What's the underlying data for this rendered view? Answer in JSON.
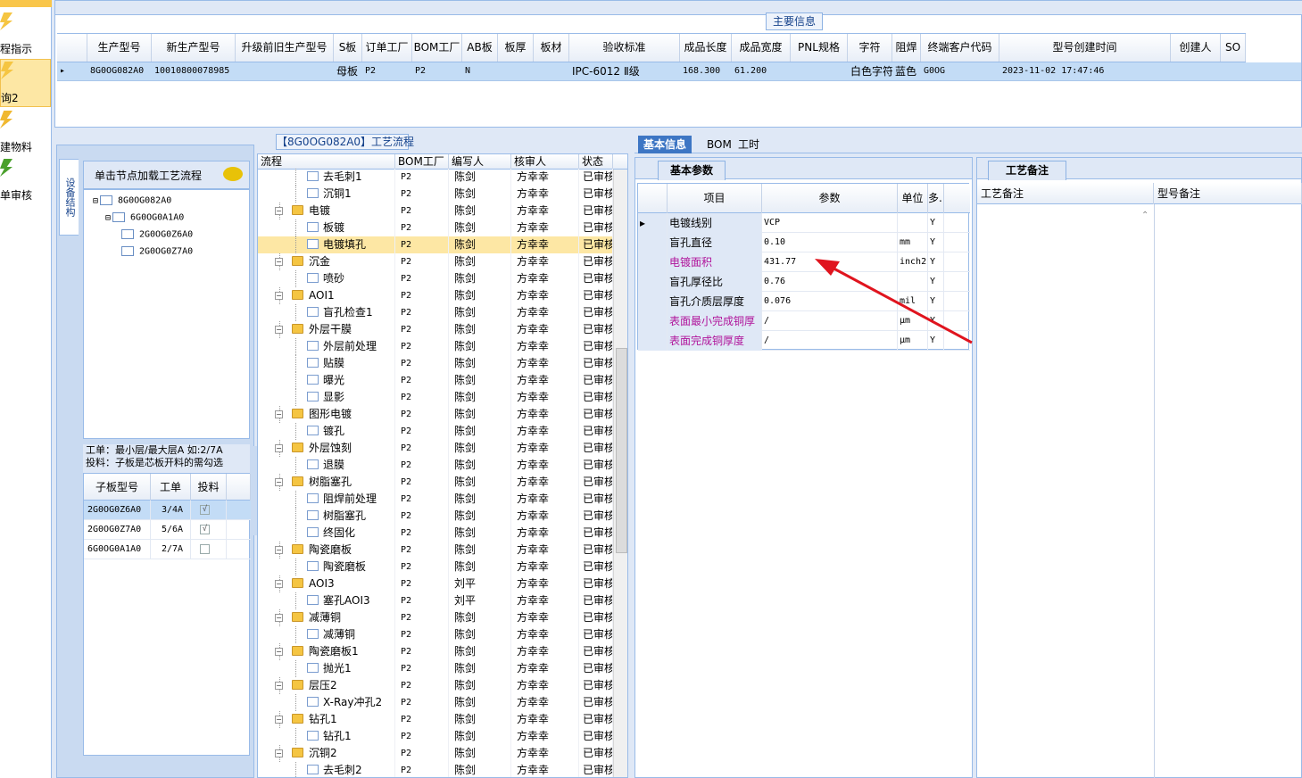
{
  "left_nav": {
    "items": [
      {
        "label": "程指示",
        "active": false
      },
      {
        "label": "询2",
        "active": true
      },
      {
        "label": "建物料",
        "active": false
      },
      {
        "label": "单审核",
        "active": false
      }
    ]
  },
  "main_info": {
    "title": "主要信息",
    "columns": [
      "生产型号",
      "新生产型号",
      "升级前旧生产型号",
      "S板",
      "订单工厂",
      "BOM工厂",
      "AB板",
      "板厚",
      "板材",
      "验收标准",
      "成品长度",
      "成品宽度",
      "PNL规格",
      "字符",
      "阻焊",
      "终端客户代码",
      "型号创建时间",
      "创建人",
      "SO"
    ],
    "row": [
      "8G0OG082A0",
      "10010800078985",
      "",
      "母板",
      "P2",
      "P2",
      "N",
      "",
      "",
      "IPC-6012 Ⅱ级",
      "168.300",
      "61.200",
      "",
      "白色字符",
      "蓝色",
      "G0OG",
      "2023-11-02 17:47:46",
      "",
      ""
    ]
  },
  "tree": {
    "tab_label": "设备结构",
    "load_label": "单击节点加载工艺流程",
    "nodes": [
      "8G0OG082A0",
      "6G0OG0A1A0",
      "2G0OG0Z6A0",
      "2G0OG0Z7A0"
    ],
    "note_line1": "工单：最小层/最大层A 如:2/7A",
    "note_line2": "投料：子板是芯板开料的需勾选"
  },
  "sub_board": {
    "columns": [
      "子板型号",
      "工单",
      "投料"
    ],
    "rows": [
      {
        "model": "2G0OG0Z6A0",
        "order": "3/4A",
        "feed": "√"
      },
      {
        "model": "2G0OG0Z7A0",
        "order": "5/6A",
        "feed": "√"
      },
      {
        "model": "6G0OG0A1A0",
        "order": "2/7A",
        "feed": ""
      }
    ]
  },
  "flow": {
    "title": "【8G0OG082A0】工艺流程",
    "columns": [
      "流程",
      "BOM工厂",
      "编写人",
      "核审人",
      "状态"
    ],
    "rows": [
      {
        "name": "去毛刺1",
        "level": 2,
        "bom": "P2",
        "writer": "陈剑",
        "reviewer": "方幸幸",
        "status": "已审核"
      },
      {
        "name": "沉铜1",
        "level": 2,
        "bom": "P2",
        "writer": "陈剑",
        "reviewer": "方幸幸",
        "status": "已审核"
      },
      {
        "name": "电镀",
        "level": 1,
        "bom": "P2",
        "writer": "陈剑",
        "reviewer": "方幸幸",
        "status": "已审核"
      },
      {
        "name": "板镀",
        "level": 2,
        "bom": "P2",
        "writer": "陈剑",
        "reviewer": "方幸幸",
        "status": "已审核"
      },
      {
        "name": "电镀填孔",
        "level": 2,
        "bom": "P2",
        "writer": "陈剑",
        "reviewer": "方幸幸",
        "status": "已审核",
        "selected": true
      },
      {
        "name": "沉金",
        "level": 1,
        "bom": "P2",
        "writer": "陈剑",
        "reviewer": "方幸幸",
        "status": "已审核"
      },
      {
        "name": "喷砂",
        "level": 2,
        "bom": "P2",
        "writer": "陈剑",
        "reviewer": "方幸幸",
        "status": "已审核"
      },
      {
        "name": "AOI1",
        "level": 1,
        "bom": "P2",
        "writer": "陈剑",
        "reviewer": "方幸幸",
        "status": "已审核"
      },
      {
        "name": "盲孔检查1",
        "level": 2,
        "bom": "P2",
        "writer": "陈剑",
        "reviewer": "方幸幸",
        "status": "已审核"
      },
      {
        "name": "外层干膜",
        "level": 1,
        "bom": "P2",
        "writer": "陈剑",
        "reviewer": "方幸幸",
        "status": "已审核"
      },
      {
        "name": "外层前处理",
        "level": 2,
        "bom": "P2",
        "writer": "陈剑",
        "reviewer": "方幸幸",
        "status": "已审核"
      },
      {
        "name": "贴膜",
        "level": 2,
        "bom": "P2",
        "writer": "陈剑",
        "reviewer": "方幸幸",
        "status": "已审核"
      },
      {
        "name": "曝光",
        "level": 2,
        "bom": "P2",
        "writer": "陈剑",
        "reviewer": "方幸幸",
        "status": "已审核"
      },
      {
        "name": "显影",
        "level": 2,
        "bom": "P2",
        "writer": "陈剑",
        "reviewer": "方幸幸",
        "status": "已审核"
      },
      {
        "name": "图形电镀",
        "level": 1,
        "bom": "P2",
        "writer": "陈剑",
        "reviewer": "方幸幸",
        "status": "已审核"
      },
      {
        "name": "镀孔",
        "level": 2,
        "bom": "P2",
        "writer": "陈剑",
        "reviewer": "方幸幸",
        "status": "已审核"
      },
      {
        "name": "外层蚀刻",
        "level": 1,
        "bom": "P2",
        "writer": "陈剑",
        "reviewer": "方幸幸",
        "status": "已审核"
      },
      {
        "name": "退膜",
        "level": 2,
        "bom": "P2",
        "writer": "陈剑",
        "reviewer": "方幸幸",
        "status": "已审核"
      },
      {
        "name": "树脂塞孔",
        "level": 1,
        "bom": "P2",
        "writer": "陈剑",
        "reviewer": "方幸幸",
        "status": "已审核"
      },
      {
        "name": "阻焊前处理",
        "level": 2,
        "bom": "P2",
        "writer": "陈剑",
        "reviewer": "方幸幸",
        "status": "已审核"
      },
      {
        "name": "树脂塞孔",
        "level": 2,
        "bom": "P2",
        "writer": "陈剑",
        "reviewer": "方幸幸",
        "status": "已审核"
      },
      {
        "name": "终固化",
        "level": 2,
        "bom": "P2",
        "writer": "陈剑",
        "reviewer": "方幸幸",
        "status": "已审核"
      },
      {
        "name": "陶瓷磨板",
        "level": 1,
        "bom": "P2",
        "writer": "陈剑",
        "reviewer": "方幸幸",
        "status": "已审核"
      },
      {
        "name": "陶瓷磨板",
        "level": 2,
        "bom": "P2",
        "writer": "陈剑",
        "reviewer": "方幸幸",
        "status": "已审核"
      },
      {
        "name": "AOI3",
        "level": 1,
        "bom": "P2",
        "writer": "刘平",
        "reviewer": "方幸幸",
        "status": "已审核"
      },
      {
        "name": "塞孔AOI3",
        "level": 2,
        "bom": "P2",
        "writer": "刘平",
        "reviewer": "方幸幸",
        "status": "已审核"
      },
      {
        "name": "减薄铜",
        "level": 1,
        "bom": "P2",
        "writer": "陈剑",
        "reviewer": "方幸幸",
        "status": "已审核"
      },
      {
        "name": "减薄铜",
        "level": 2,
        "bom": "P2",
        "writer": "陈剑",
        "reviewer": "方幸幸",
        "status": "已审核"
      },
      {
        "name": "陶瓷磨板1",
        "level": 1,
        "bom": "P2",
        "writer": "陈剑",
        "reviewer": "方幸幸",
        "status": "已审核"
      },
      {
        "name": "抛光1",
        "level": 2,
        "bom": "P2",
        "writer": "陈剑",
        "reviewer": "方幸幸",
        "status": "已审核"
      },
      {
        "name": "层压2",
        "level": 1,
        "bom": "P2",
        "writer": "陈剑",
        "reviewer": "方幸幸",
        "status": "已审核"
      },
      {
        "name": "X-Ray冲孔2",
        "level": 2,
        "bom": "P2",
        "writer": "陈剑",
        "reviewer": "方幸幸",
        "status": "已审核"
      },
      {
        "name": "钻孔1",
        "level": 1,
        "bom": "P2",
        "writer": "陈剑",
        "reviewer": "方幸幸",
        "status": "已审核"
      },
      {
        "name": "钻孔1",
        "level": 2,
        "bom": "P2",
        "writer": "陈剑",
        "reviewer": "方幸幸",
        "status": "已审核"
      },
      {
        "name": "沉铜2",
        "level": 1,
        "bom": "P2",
        "writer": "陈剑",
        "reviewer": "方幸幸",
        "status": "已审核"
      },
      {
        "name": "去毛刺2",
        "level": 2,
        "bom": "P2",
        "writer": "陈剑",
        "reviewer": "方幸幸",
        "status": "已审核"
      }
    ]
  },
  "right_tabs": [
    "基本信息",
    "BOM",
    "工时"
  ],
  "basic_params": {
    "tab": "基本参数",
    "columns": [
      "项目",
      "参数",
      "单位",
      "多.."
    ],
    "rows": [
      {
        "item": "电镀线别",
        "value": "VCP",
        "unit": "",
        "flag": "Y",
        "magenta": false
      },
      {
        "item": "盲孔直径",
        "value": "0.10",
        "unit": "mm",
        "flag": "Y",
        "magenta": false
      },
      {
        "item": "电镀面积",
        "value": "431.77",
        "unit": "inch2",
        "flag": "Y",
        "magenta": true
      },
      {
        "item": "盲孔厚径比",
        "value": "0.76",
        "unit": "",
        "flag": "Y",
        "magenta": false
      },
      {
        "item": "盲孔介质层厚度",
        "value": "0.076",
        "unit": "mil",
        "flag": "Y",
        "magenta": false
      },
      {
        "item": "表面最小完成铜厚",
        "value": "/",
        "unit": "μm",
        "flag": "Y",
        "magenta": true
      },
      {
        "item": "表面完成铜厚度",
        "value": "/",
        "unit": "μm",
        "flag": "Y",
        "magenta": true
      }
    ]
  },
  "remarks": {
    "tab": "工艺备注",
    "columns": [
      "工艺备注",
      "型号备注"
    ]
  },
  "colors": {
    "accent": "#3d76c4",
    "border": "#99bbe8",
    "selected_row": "#fde7a4",
    "magenta": "#b0149b",
    "arrow": "#e0141e"
  }
}
